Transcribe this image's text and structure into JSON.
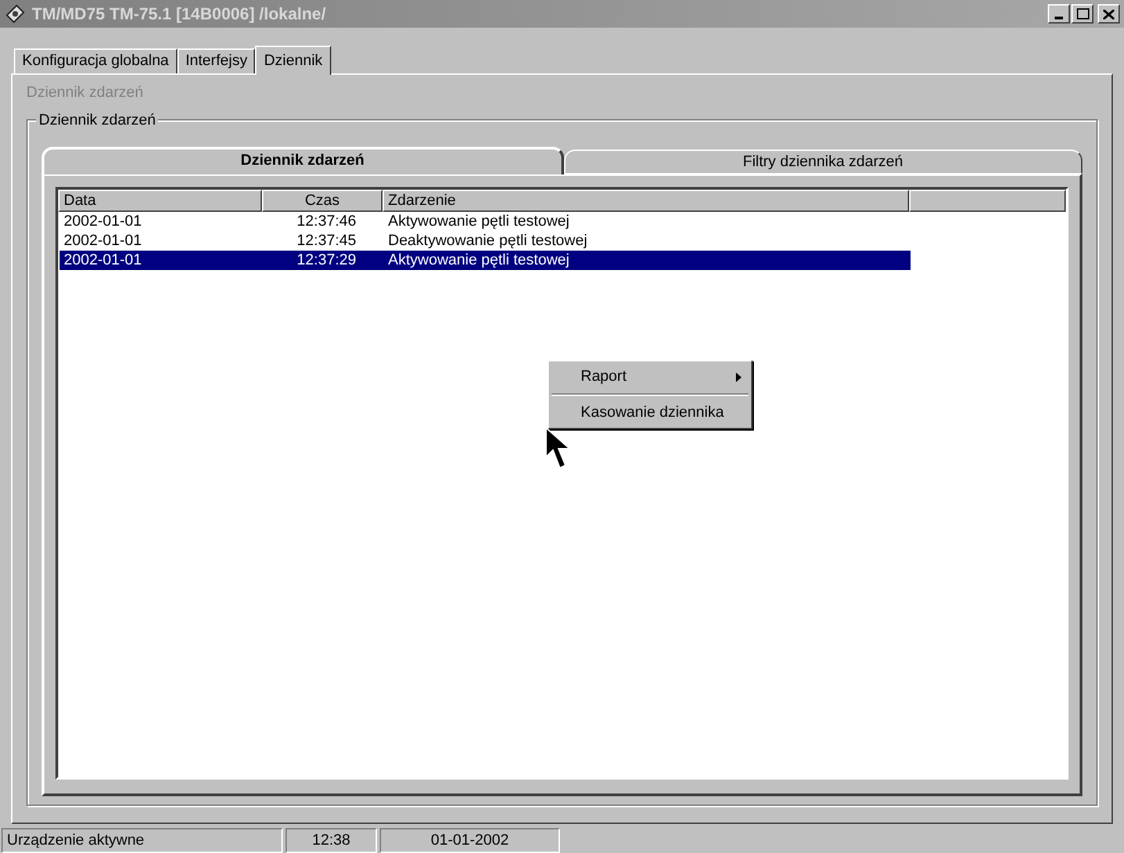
{
  "window": {
    "title": "TM/MD75 TM-75.1 [14B0006] /lokalne/"
  },
  "tabs": [
    {
      "label": "Konfiguracja globalna",
      "selected": false
    },
    {
      "label": "Interfejsy",
      "selected": false
    },
    {
      "label": "Dziennik",
      "selected": true
    }
  ],
  "page_heading": {
    "text": "Dziennik zdarzeń",
    "disabled": true
  },
  "group": {
    "label": "Dziennik zdarzeń"
  },
  "inner_tabs": [
    {
      "label": "Dziennik zdarzeń",
      "selected": true
    },
    {
      "label": "Filtry dziennika zdarzeń",
      "selected": false
    }
  ],
  "table": {
    "columns": [
      "Data",
      "Czas",
      "Zdarzenie"
    ],
    "rows": [
      {
        "cells": [
          "2002-01-01",
          "12:37:46",
          "Aktywowanie pętli testowej"
        ],
        "selected": false
      },
      {
        "cells": [
          "2002-01-01",
          "12:37:45",
          "Deaktywowanie pętli testowej"
        ],
        "selected": false
      },
      {
        "cells": [
          "2002-01-01",
          "12:37:29",
          "Aktywowanie pętli testowej"
        ],
        "selected": true
      }
    ]
  },
  "context_menu": {
    "items": [
      {
        "label": "Raport",
        "kind": "submenu"
      },
      {
        "kind": "separator"
      },
      {
        "label": "Kasowanie dziennika",
        "kind": "item"
      }
    ]
  },
  "status_bar": [
    "Urządzenie aktywne",
    "12:38",
    "01-01-2002"
  ]
}
